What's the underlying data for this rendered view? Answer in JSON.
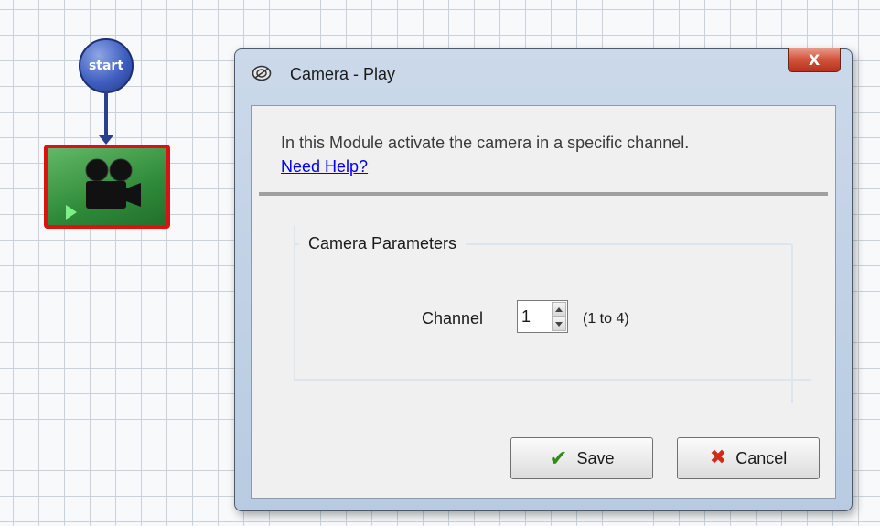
{
  "flow": {
    "start_label": "start"
  },
  "dialog": {
    "title": "Camera - Play",
    "close_label": "X",
    "description": "In this Module activate the camera in a specific channel.",
    "help_link": "Need Help?",
    "group_title": "Camera Parameters",
    "channel_label": "Channel",
    "channel_value": "1",
    "range_label": "(1 to 4)",
    "save_label": "Save",
    "cancel_label": "Cancel"
  },
  "colors": {
    "selection_border": "#e01010",
    "node_green": "#2f8b3a",
    "start_blue": "#3f5fbf",
    "link_blue": "#0000ee",
    "save_check": "#2f8d16",
    "cancel_x": "#d42a1a"
  },
  "icons": {
    "start_node": "circle-node",
    "camera_node": "movie-camera-icon",
    "title_icon": "camera-lens-icon",
    "save_icon": "checkmark-icon",
    "cancel_icon": "x-mark-icon"
  }
}
